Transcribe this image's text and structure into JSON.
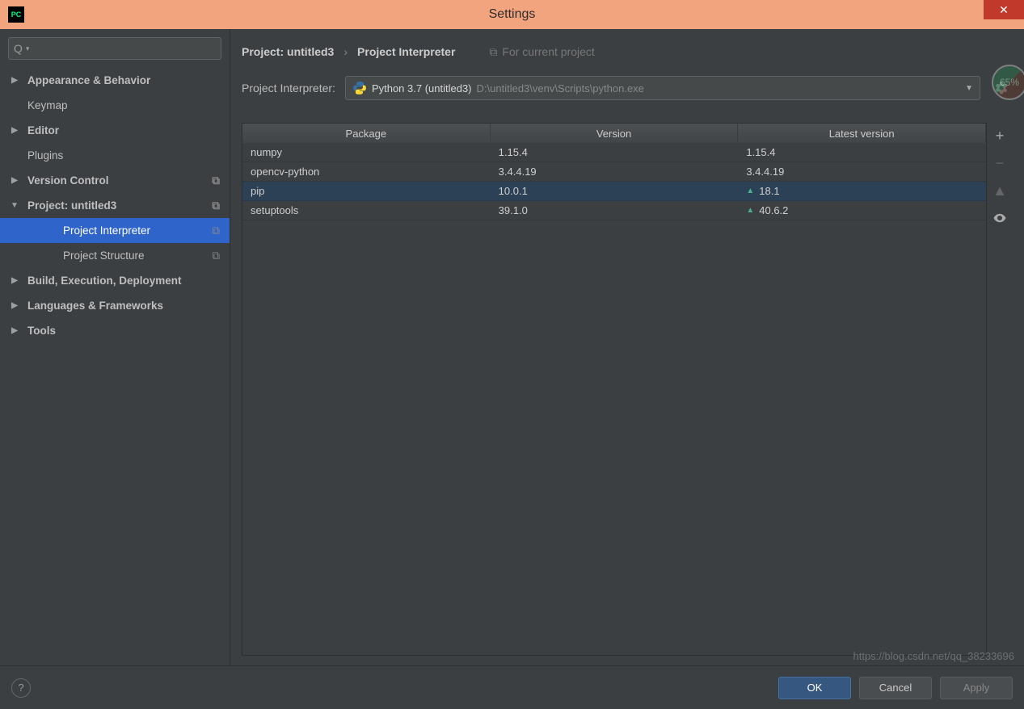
{
  "window": {
    "title": "Settings"
  },
  "search": {
    "placeholder": ""
  },
  "sidebar": {
    "items": [
      {
        "label": "Appearance & Behavior",
        "expand": "▶",
        "bold": true
      },
      {
        "label": "Keymap",
        "expand": "",
        "bold": false
      },
      {
        "label": "Editor",
        "expand": "▶",
        "bold": true
      },
      {
        "label": "Plugins",
        "expand": "",
        "bold": false
      },
      {
        "label": "Version Control",
        "expand": "▶",
        "bold": true,
        "copy": true
      },
      {
        "label": "Project: untitled3",
        "expand": "▼",
        "bold": true,
        "copy": true
      },
      {
        "label": "Project Interpreter",
        "expand": "",
        "child": true,
        "selected": true,
        "copy": true
      },
      {
        "label": "Project Structure",
        "expand": "",
        "child": true,
        "copy": true
      },
      {
        "label": "Build, Execution, Deployment",
        "expand": "▶",
        "bold": true
      },
      {
        "label": "Languages & Frameworks",
        "expand": "▶",
        "bold": true
      },
      {
        "label": "Tools",
        "expand": "▶",
        "bold": true
      }
    ]
  },
  "breadcrumb": {
    "root": "Project: untitled3",
    "current": "Project Interpreter",
    "hint": "For current project"
  },
  "interpreter": {
    "label": "Project Interpreter:",
    "name": "Python 3.7 (untitled3)",
    "path": "D:\\untitled3\\venv\\Scripts\\python.exe"
  },
  "table": {
    "headers": {
      "pkg": "Package",
      "ver": "Version",
      "latest": "Latest version"
    },
    "rows": [
      {
        "pkg": "numpy",
        "ver": "1.15.4",
        "latest": "1.15.4",
        "updatable": false,
        "selected": false
      },
      {
        "pkg": "opencv-python",
        "ver": "3.4.4.19",
        "latest": "3.4.4.19",
        "updatable": false,
        "selected": false
      },
      {
        "pkg": "pip",
        "ver": "10.0.1",
        "latest": "18.1",
        "updatable": true,
        "selected": true
      },
      {
        "pkg": "setuptools",
        "ver": "39.1.0",
        "latest": "40.6.2",
        "updatable": true,
        "selected": false
      }
    ]
  },
  "buttons": {
    "ok": "OK",
    "cancel": "Cancel",
    "apply": "Apply"
  },
  "badge": "65%",
  "watermark": "https://blog.csdn.net/qq_38233696"
}
